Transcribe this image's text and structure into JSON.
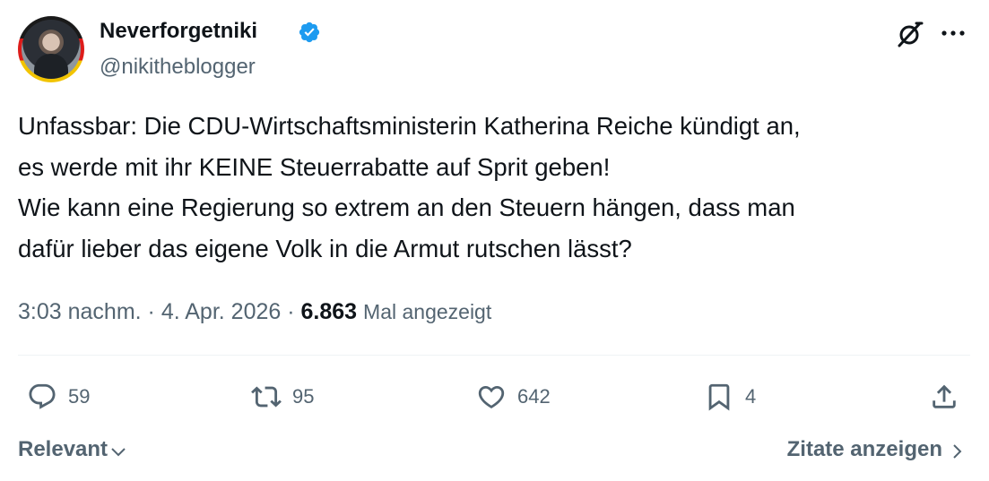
{
  "author": {
    "display_name": "Neverforgetniki",
    "handle": "@nikitheblogger",
    "verified": true,
    "verified_color": "#1d9bf0"
  },
  "tweet": {
    "lines": [
      "Unfassbar: Die CDU-Wirtschaftsministerin Katherina Reiche kündigt an,",
      "es werde mit ihr KEINE Steuerrabatte auf Sprit geben!",
      "Wie kann eine Regierung so extrem an den Steuern hängen, dass man",
      "dafür lieber das eigene Volk in die Armut rutschen lässt?"
    ]
  },
  "meta": {
    "time": "3:03 nachm.",
    "separator": "·",
    "date": "4. Apr. 2026",
    "views_count": "6.863",
    "views_label": "Mal angezeigt"
  },
  "actions": {
    "replies": "59",
    "reposts": "95",
    "likes": "642",
    "bookmarks": "4"
  },
  "footer": {
    "sort_label": "Relevant",
    "quotes_label": "Zitate anzeigen"
  },
  "icons": {
    "verified": "verified-badge-icon",
    "grok": "grok-icon",
    "more": "more-icon",
    "reply": "reply-icon",
    "repost": "repost-icon",
    "like": "heart-icon",
    "bookmark": "bookmark-icon",
    "share": "share-icon"
  },
  "colors": {
    "text_primary": "#0f1419",
    "text_secondary": "#536471",
    "divider": "#eff3f4"
  }
}
